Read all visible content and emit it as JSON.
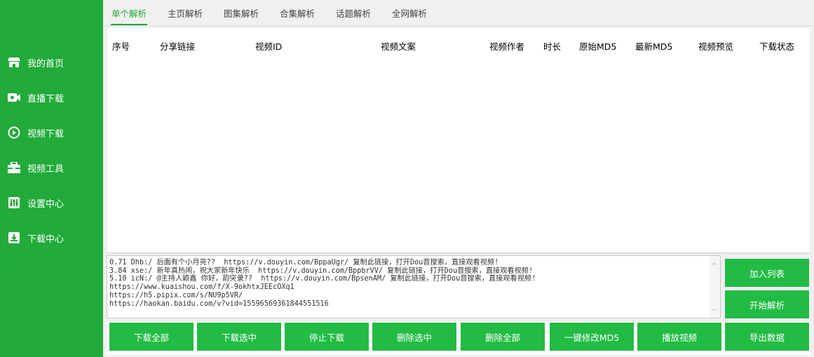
{
  "sidebar": {
    "items": [
      {
        "label": "我的首页",
        "icon": "store-icon"
      },
      {
        "label": "直播下载",
        "icon": "live-camera-icon"
      },
      {
        "label": "视频下载",
        "icon": "play-circle-icon"
      },
      {
        "label": "视频工具",
        "icon": "toolbox-icon"
      },
      {
        "label": "设置中心",
        "icon": "sliders-icon"
      },
      {
        "label": "下载中心",
        "icon": "download-box-icon"
      }
    ]
  },
  "tabs": [
    {
      "label": "单个解析",
      "active": true
    },
    {
      "label": "主页解析"
    },
    {
      "label": "图集解析"
    },
    {
      "label": "合集解析"
    },
    {
      "label": "话题解析"
    },
    {
      "label": "全网解析"
    }
  ],
  "table": {
    "columns": [
      "序号",
      "分享链接",
      "视频ID",
      "视频文案",
      "视频作者",
      "时长",
      "原始MD5",
      "最新MD5",
      "视频预览",
      "下载状态"
    ]
  },
  "input": {
    "lines": [
      "0.71 Dhb:/ 后面有个小月亮??  https://v.douyin.com/BppaUgr/ 复制此链接，打开Dou音搜索，直接观看视频!",
      "3.84 xse:/ 新年真热闹，祝大家新年快乐  https://v.douyin.com/BppbrVV/ 复制此链接，打开Dou音搜索，直接观看视频!",
      "5.10 icN:/ @主持人颖鑫 你好，韵突录??  https://v.douyin.com/BpsenAM/ 复制此链接，打开Dou音搜索，直接观看视频!",
      "https://www.kuaishou.com/f/X-9okhtxJEEcOXq1",
      "https://h5.pipix.com/s/NU9p5VR/",
      "https://haokan.baidu.com/v?vid=15596569361844551516"
    ]
  },
  "side_buttons": {
    "add_list": "加入列表",
    "start_parse": "开始解析"
  },
  "bottom_buttons": [
    "下载全部",
    "下载选中",
    "停止下载",
    "删除选中",
    "删除全部",
    "一键修改MD5",
    "播放视频",
    "导出数据"
  ],
  "colors": {
    "sidebar": "#22aa3a",
    "button": "#22bb44",
    "accent": "#22aa3a"
  }
}
